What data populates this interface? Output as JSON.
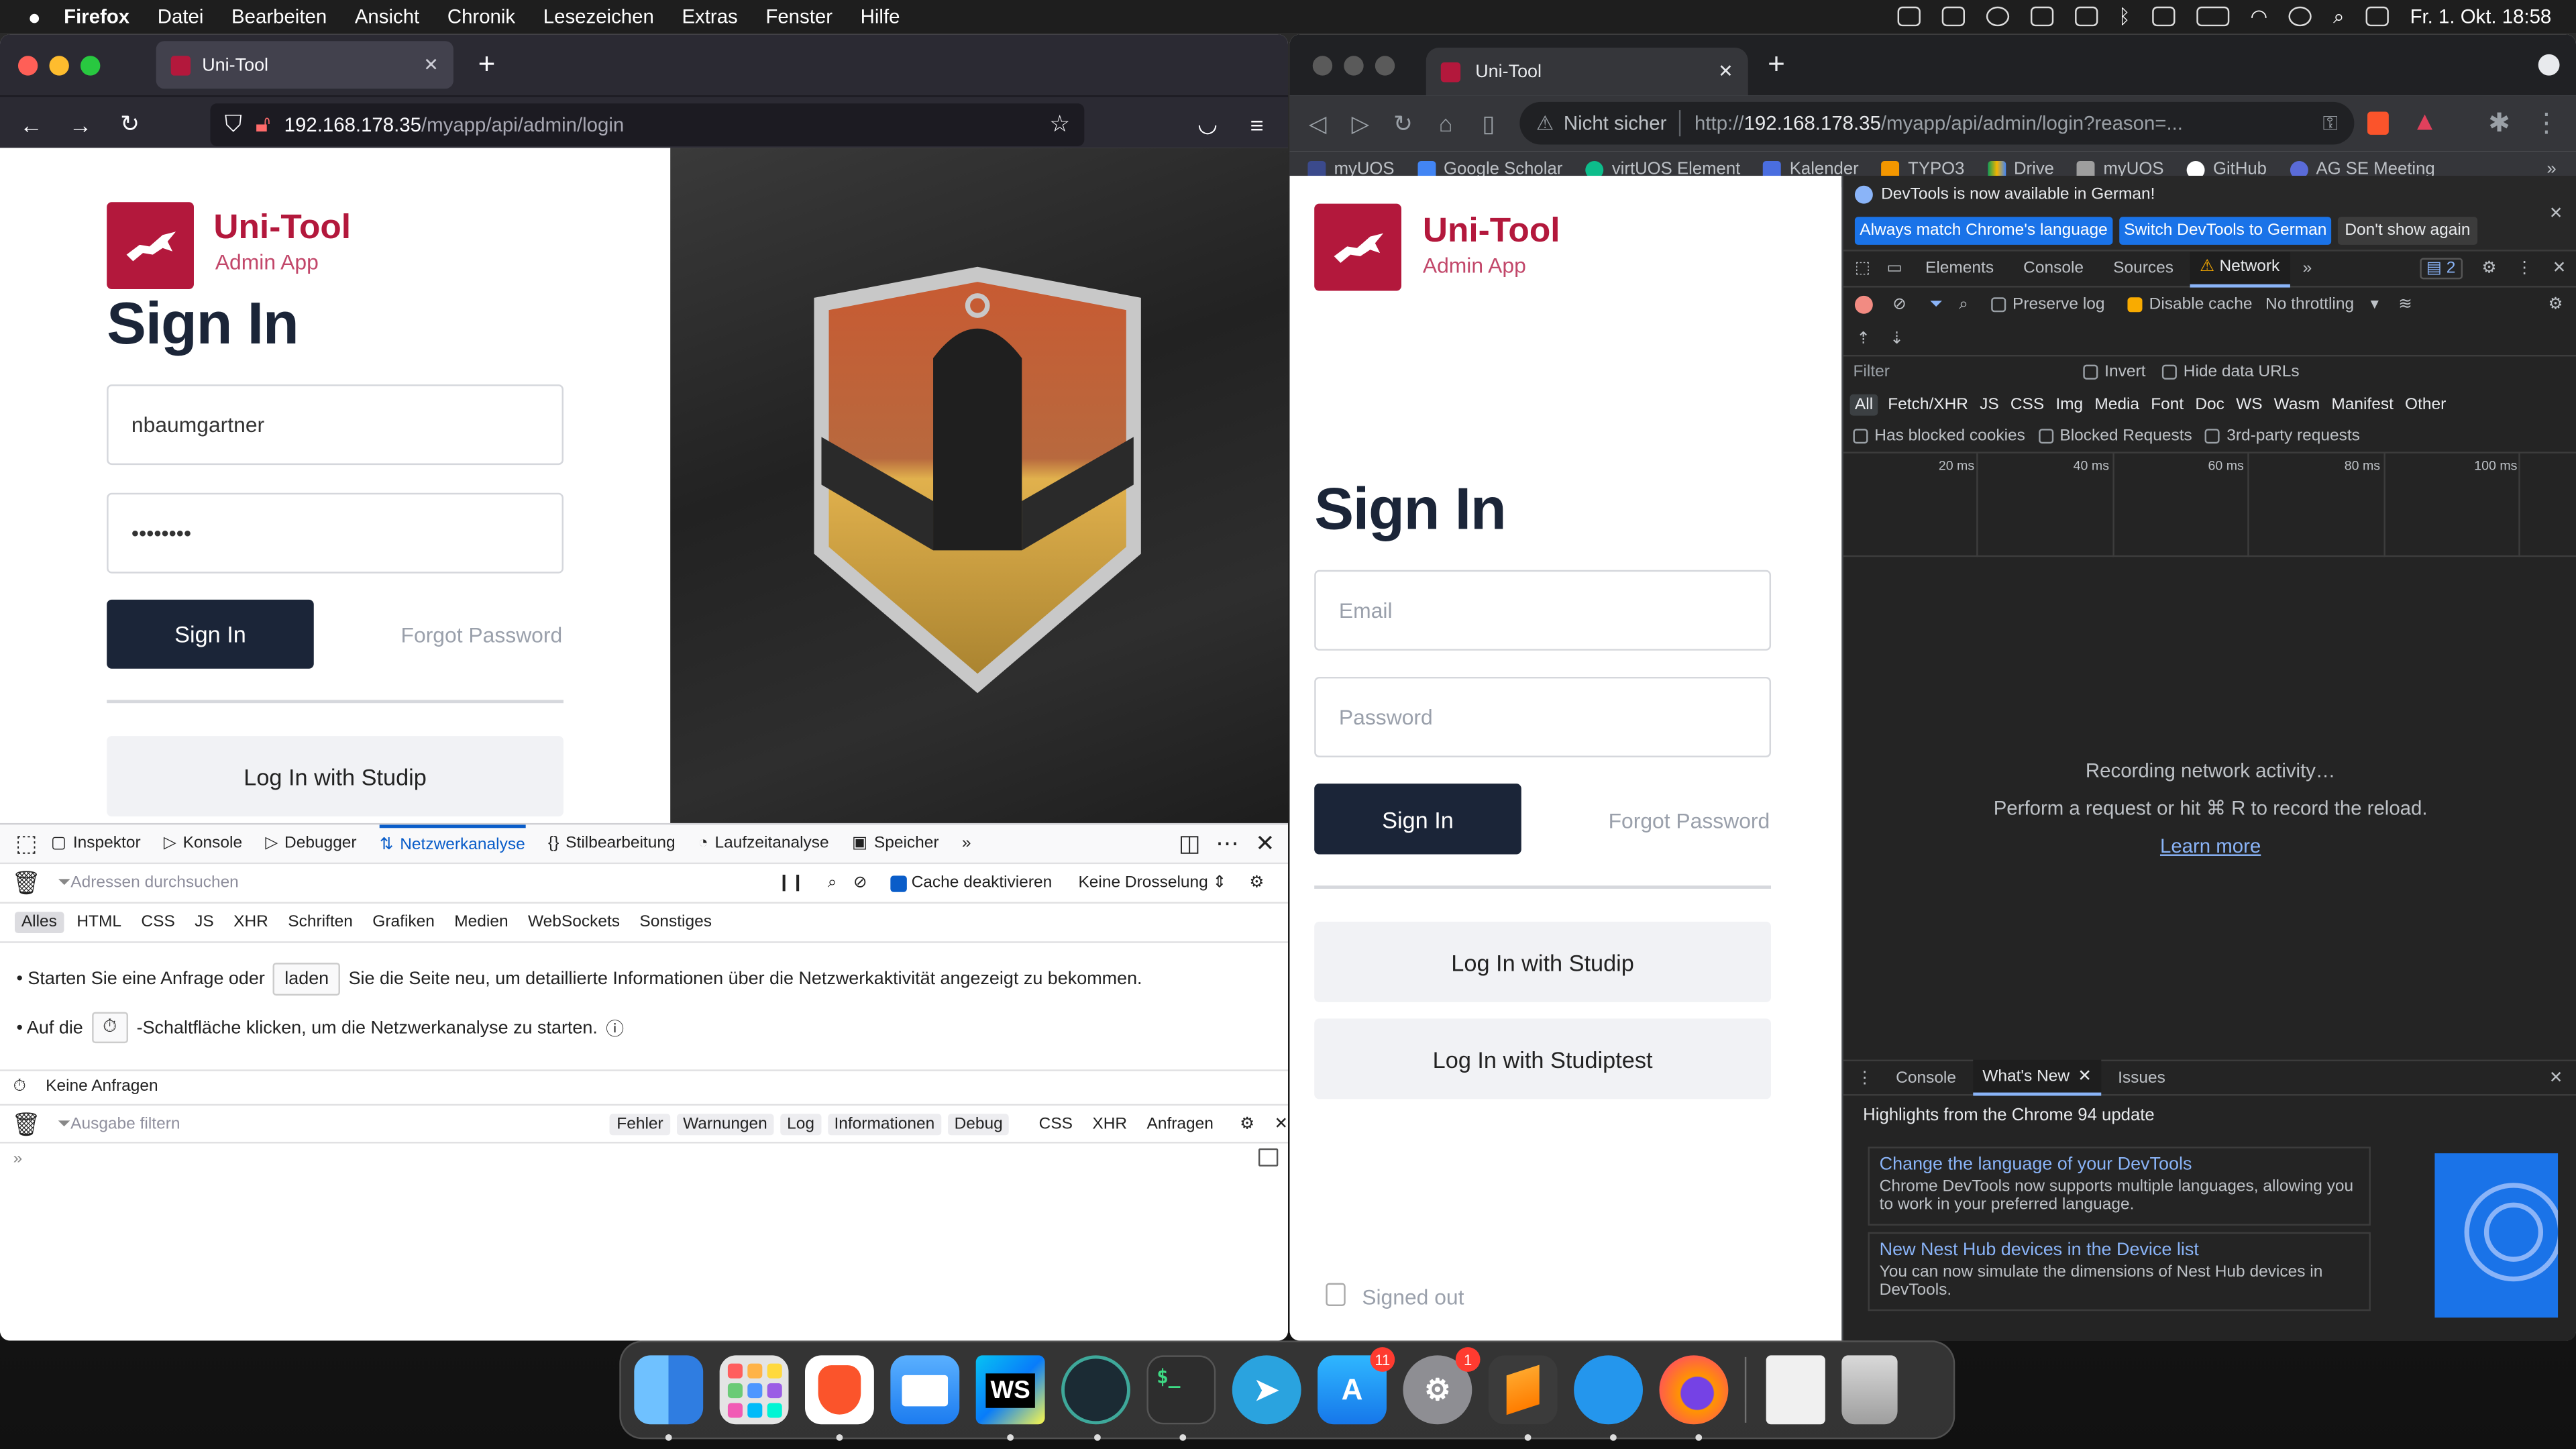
{
  "menubar": {
    "app": "Firefox",
    "items": [
      "Datei",
      "Bearbeiten",
      "Ansicht",
      "Chronik",
      "Lesezeichen",
      "Extras",
      "Fenster",
      "Hilfe"
    ],
    "clock": "Fr. 1. Okt. 18:58"
  },
  "firefox": {
    "tab_title": "Uni-Tool",
    "url_host": "192.168.178.35",
    "url_path": "/myapp/api/admin/login",
    "page": {
      "brand": "Uni-Tool",
      "brand_sub": "Admin App",
      "heading": "Sign In",
      "username_value": "nbaumgartner",
      "password_value": "••••••••",
      "signin_label": "Sign In",
      "forgot_label": "Forgot Password",
      "studip_label": "Log In with Studip"
    },
    "devtools": {
      "tabs": [
        "Inspektor",
        "Konsole",
        "Debugger",
        "Netzwerkanalyse",
        "Stilbearbeitung",
        "Laufzeitanalyse",
        "Speicher"
      ],
      "filter_placeholder": "Adressen durchsuchen",
      "cache_label": "Cache deaktivieren",
      "throttle_label": "Keine Drosselung ⇕",
      "types": [
        "Alles",
        "HTML",
        "CSS",
        "JS",
        "XHR",
        "Schriften",
        "Grafiken",
        "Medien",
        "WebSockets",
        "Sonstiges"
      ],
      "msg1_pre": "• Starten Sie eine Anfrage oder",
      "msg1_btn": "laden",
      "msg1_post": "Sie die Seite neu, um detaillierte Informationen über die Netzwerkaktivität angezeigt zu bekommen.",
      "msg2_pre": "• Auf die",
      "msg2_post": "-Schaltfläche klicken, um die Netzwerkanalyse zu starten.",
      "no_requests": "Keine Anfragen",
      "console_filter": "Ausgabe filtern",
      "console_levels": [
        "Fehler",
        "Warnungen",
        "Log",
        "Informationen",
        "Debug"
      ],
      "console_types": [
        "CSS",
        "XHR",
        "Anfragen"
      ]
    }
  },
  "chrome": {
    "tab_title": "Uni-Tool",
    "not_secure": "Nicht sicher",
    "url_scheme": "http://",
    "url_host": "192.168.178.35",
    "url_rest": "/myapp/api/admin/login?reason=...",
    "bookmarks": [
      "myUOS",
      "Google Scholar",
      "virtUOS Element",
      "Kalender",
      "TYPO3",
      "Drive",
      "myUOS",
      "GitHub",
      "AG SE Meeting"
    ],
    "page": {
      "brand": "Uni-Tool",
      "brand_sub": "Admin App",
      "heading": "Sign In",
      "email_placeholder": "Email",
      "password_placeholder": "Password",
      "signin_label": "Sign In",
      "forgot_label": "Forgot Password",
      "studip_label": "Log In with Studip",
      "studiptest_label": "Log In with Studiptest",
      "signed_out": "Signed out"
    },
    "devtools": {
      "notice": "DevTools is now available in German!",
      "btn_match": "Always match Chrome's language",
      "btn_switch": "Switch DevTools to German",
      "btn_dont": "Don't show again",
      "tabs": [
        "Elements",
        "Console",
        "Sources",
        "Network"
      ],
      "issues_count": "2",
      "preserve_log": "Preserve log",
      "disable_cache": "Disable cache",
      "throttling": "No throttling",
      "filter_placeholder": "Filter",
      "invert": "Invert",
      "hide_data_urls": "Hide data URLs",
      "types": [
        "All",
        "Fetch/XHR",
        "JS",
        "CSS",
        "Img",
        "Media",
        "Font",
        "Doc",
        "WS",
        "Wasm",
        "Manifest",
        "Other"
      ],
      "has_blocked": "Has blocked cookies",
      "blocked_requests": "Blocked Requests",
      "third_party": "3rd-party requests",
      "ticks": [
        "20 ms",
        "40 ms",
        "60 ms",
        "80 ms",
        "100 ms"
      ],
      "recording": "Recording network activity…",
      "perform": "Perform a request or hit ⌘ R to record the reload.",
      "learn_more": "Learn more",
      "drawer_tabs": [
        "Console",
        "What's New",
        "Issues"
      ],
      "highlights": "Highlights from the Chrome 94 update",
      "card1_title": "Change the language of your DevTools",
      "card1_body": "Chrome DevTools now supports multiple languages, allowing you to work in your preferred language.",
      "card2_title": "New Nest Hub devices in the Device list",
      "card2_body": "You can now simulate the dimensions of Nest Hub devices in DevTools."
    }
  },
  "dock": {
    "apps": [
      "finder-icon",
      "launchpad-icon",
      "brave-icon",
      "mail-icon",
      "webstorm-icon",
      "gitkraken-icon",
      "terminal-icon",
      "telegram-icon",
      "appstore-icon",
      "settings-icon",
      "sublime-icon",
      "docker-icon",
      "firefox-icon",
      "documents-icon",
      "trash-icon"
    ],
    "webstorm_label": "WS",
    "terminal_label": "$_",
    "appstore_badge": "11",
    "settings_badge": "1"
  }
}
